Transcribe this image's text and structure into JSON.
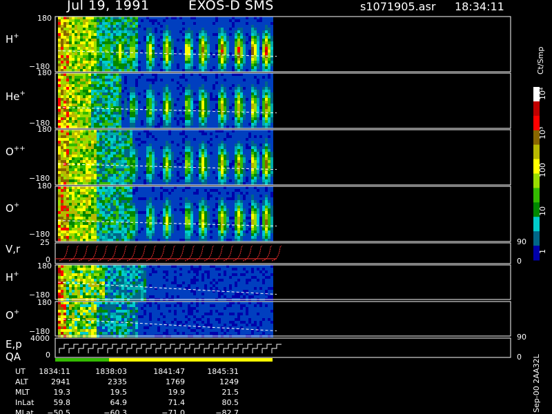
{
  "header": {
    "date": "Jul 19, 1991",
    "instrument": "EXOS-D SMS",
    "file": "s1071905.asr",
    "time": "18:34:11"
  },
  "panels": [
    {
      "id": "hplus_pa",
      "label": "H",
      "sup": "+",
      "ymax": "180",
      "ymin": "−180"
    },
    {
      "id": "heplus_pa",
      "label": "He",
      "sup": "+",
      "ymax": "180",
      "ymin": "−180"
    },
    {
      "id": "oplusplus_pa",
      "label": "O",
      "sup": "++",
      "ymax": "180",
      "ymin": "−180"
    },
    {
      "id": "oplus_pa",
      "label": "O",
      "sup": "+",
      "ymax": "180",
      "ymin": "−180"
    },
    {
      "id": "vr",
      "label": "V,r",
      "ytop": "25",
      "ybot": "0",
      "rtop": "90",
      "rbot": "0"
    },
    {
      "id": "hplus_e",
      "label": "H",
      "sup": "+",
      "ymax": "180",
      "ymin": "−180"
    },
    {
      "id": "oplus_e",
      "label": "O",
      "sup": "+",
      "ymax": "180",
      "ymin": "−180"
    },
    {
      "id": "ep",
      "label": "E,p",
      "label2": "QA",
      "ytop": "4000",
      "ybot": "0",
      "rtop": "90",
      "rbot": "0"
    }
  ],
  "colorbar": {
    "unit": "Ct/Smp",
    "ticks": [
      "10⁴",
      "10³",
      "100",
      "10",
      "1"
    ],
    "colors": [
      "#ffffff",
      "#c00000",
      "#ff0000",
      "#886600",
      "#b8b800",
      "#ffff00",
      "#99dd00",
      "#33bb00",
      "#008800",
      "#00cccc",
      "#006688",
      "#0000aa"
    ]
  },
  "footer": {
    "row_labels": [
      "UT",
      "ALT",
      "MLT",
      "InLat",
      "MLat"
    ],
    "columns": [
      [
        "1834:11",
        "2941",
        "19.3",
        "59.8",
        "−50.5"
      ],
      [
        "1838:03",
        "2335",
        "19.5",
        "64.9",
        "−60.3"
      ],
      [
        "1841:47",
        "1769",
        "19.9",
        "71.4",
        "−71.0"
      ],
      [
        "1845:31",
        "1249",
        "21.5",
        "80.5",
        "−82.7"
      ]
    ]
  },
  "side_stamp": "Sep-00 2AA32L"
}
